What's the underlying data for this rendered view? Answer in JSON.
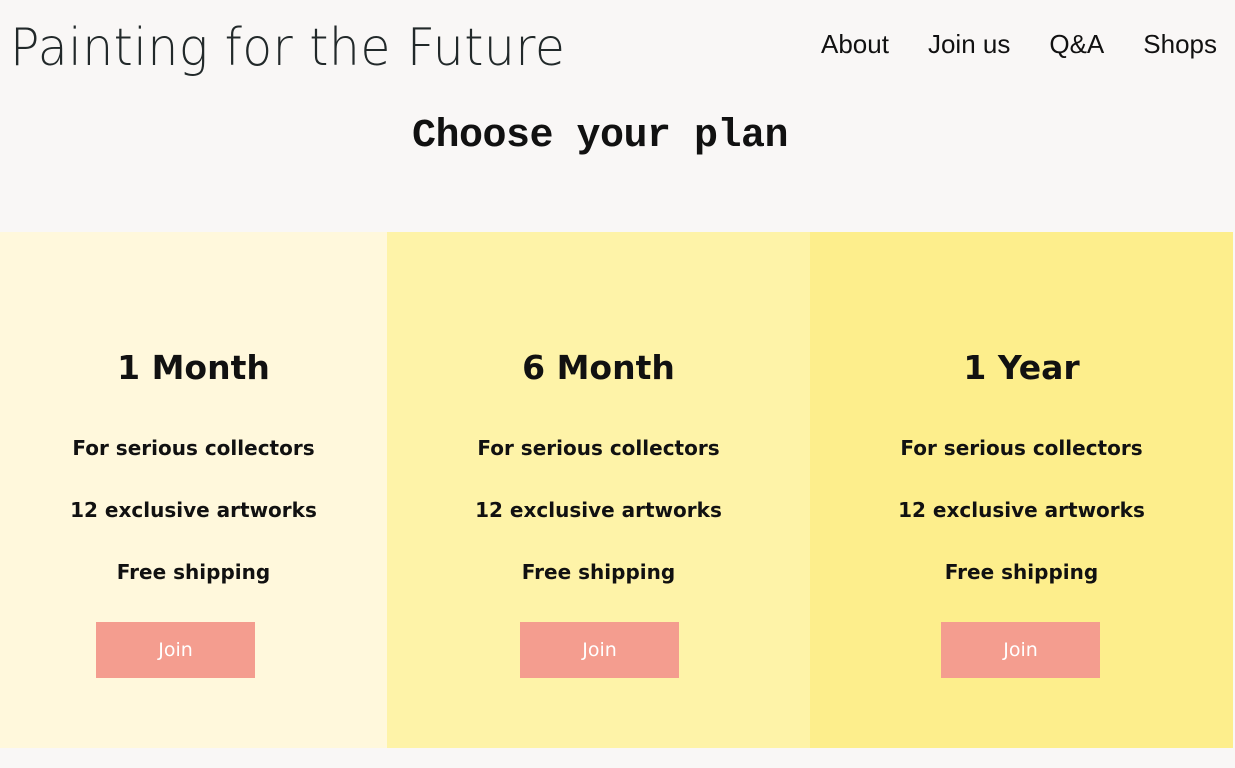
{
  "header": {
    "brand": "Painting for the Future",
    "nav": [
      "About",
      "Join us",
      "Q&A",
      "Shops"
    ]
  },
  "main": {
    "title": "Choose your plan",
    "plans": [
      {
        "name": "1 Month",
        "features": [
          "For serious collectors",
          "12 exclusive artworks",
          "Free shipping"
        ],
        "button_label": "Join",
        "background": "#fff8dc"
      },
      {
        "name": "6 Month",
        "features": [
          "For serious collectors",
          "12 exclusive artworks",
          "Free shipping"
        ],
        "button_label": "Join",
        "background": "#fef3a8"
      },
      {
        "name": "1 Year",
        "features": [
          "For serious collectors",
          "12 exclusive artworks",
          "Free shipping"
        ],
        "button_label": "Join",
        "background": "#fdee8c"
      }
    ]
  },
  "colors": {
    "page_background": "#f9f7f6",
    "button": "#f49d8f",
    "button_text": "#ffffff"
  }
}
